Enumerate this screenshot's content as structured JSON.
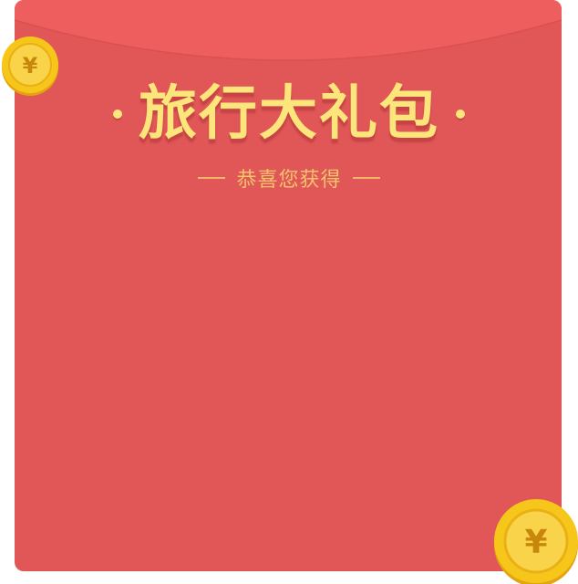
{
  "envelope": {
    "title": "旅行大礼包",
    "subtitle": "恭喜您获得"
  },
  "coins": {
    "symbol": "¥"
  },
  "colors": {
    "envelope_body": "#e15757",
    "envelope_flap": "#ef5e5e",
    "title_gold": "#fce57a",
    "subtitle_gold": "#f5c36e",
    "coin_gold": "#f7c61b"
  },
  "icons": {
    "coin_top_left": "yuan-coin-icon",
    "coin_bottom_right": "yuan-coin-icon"
  }
}
